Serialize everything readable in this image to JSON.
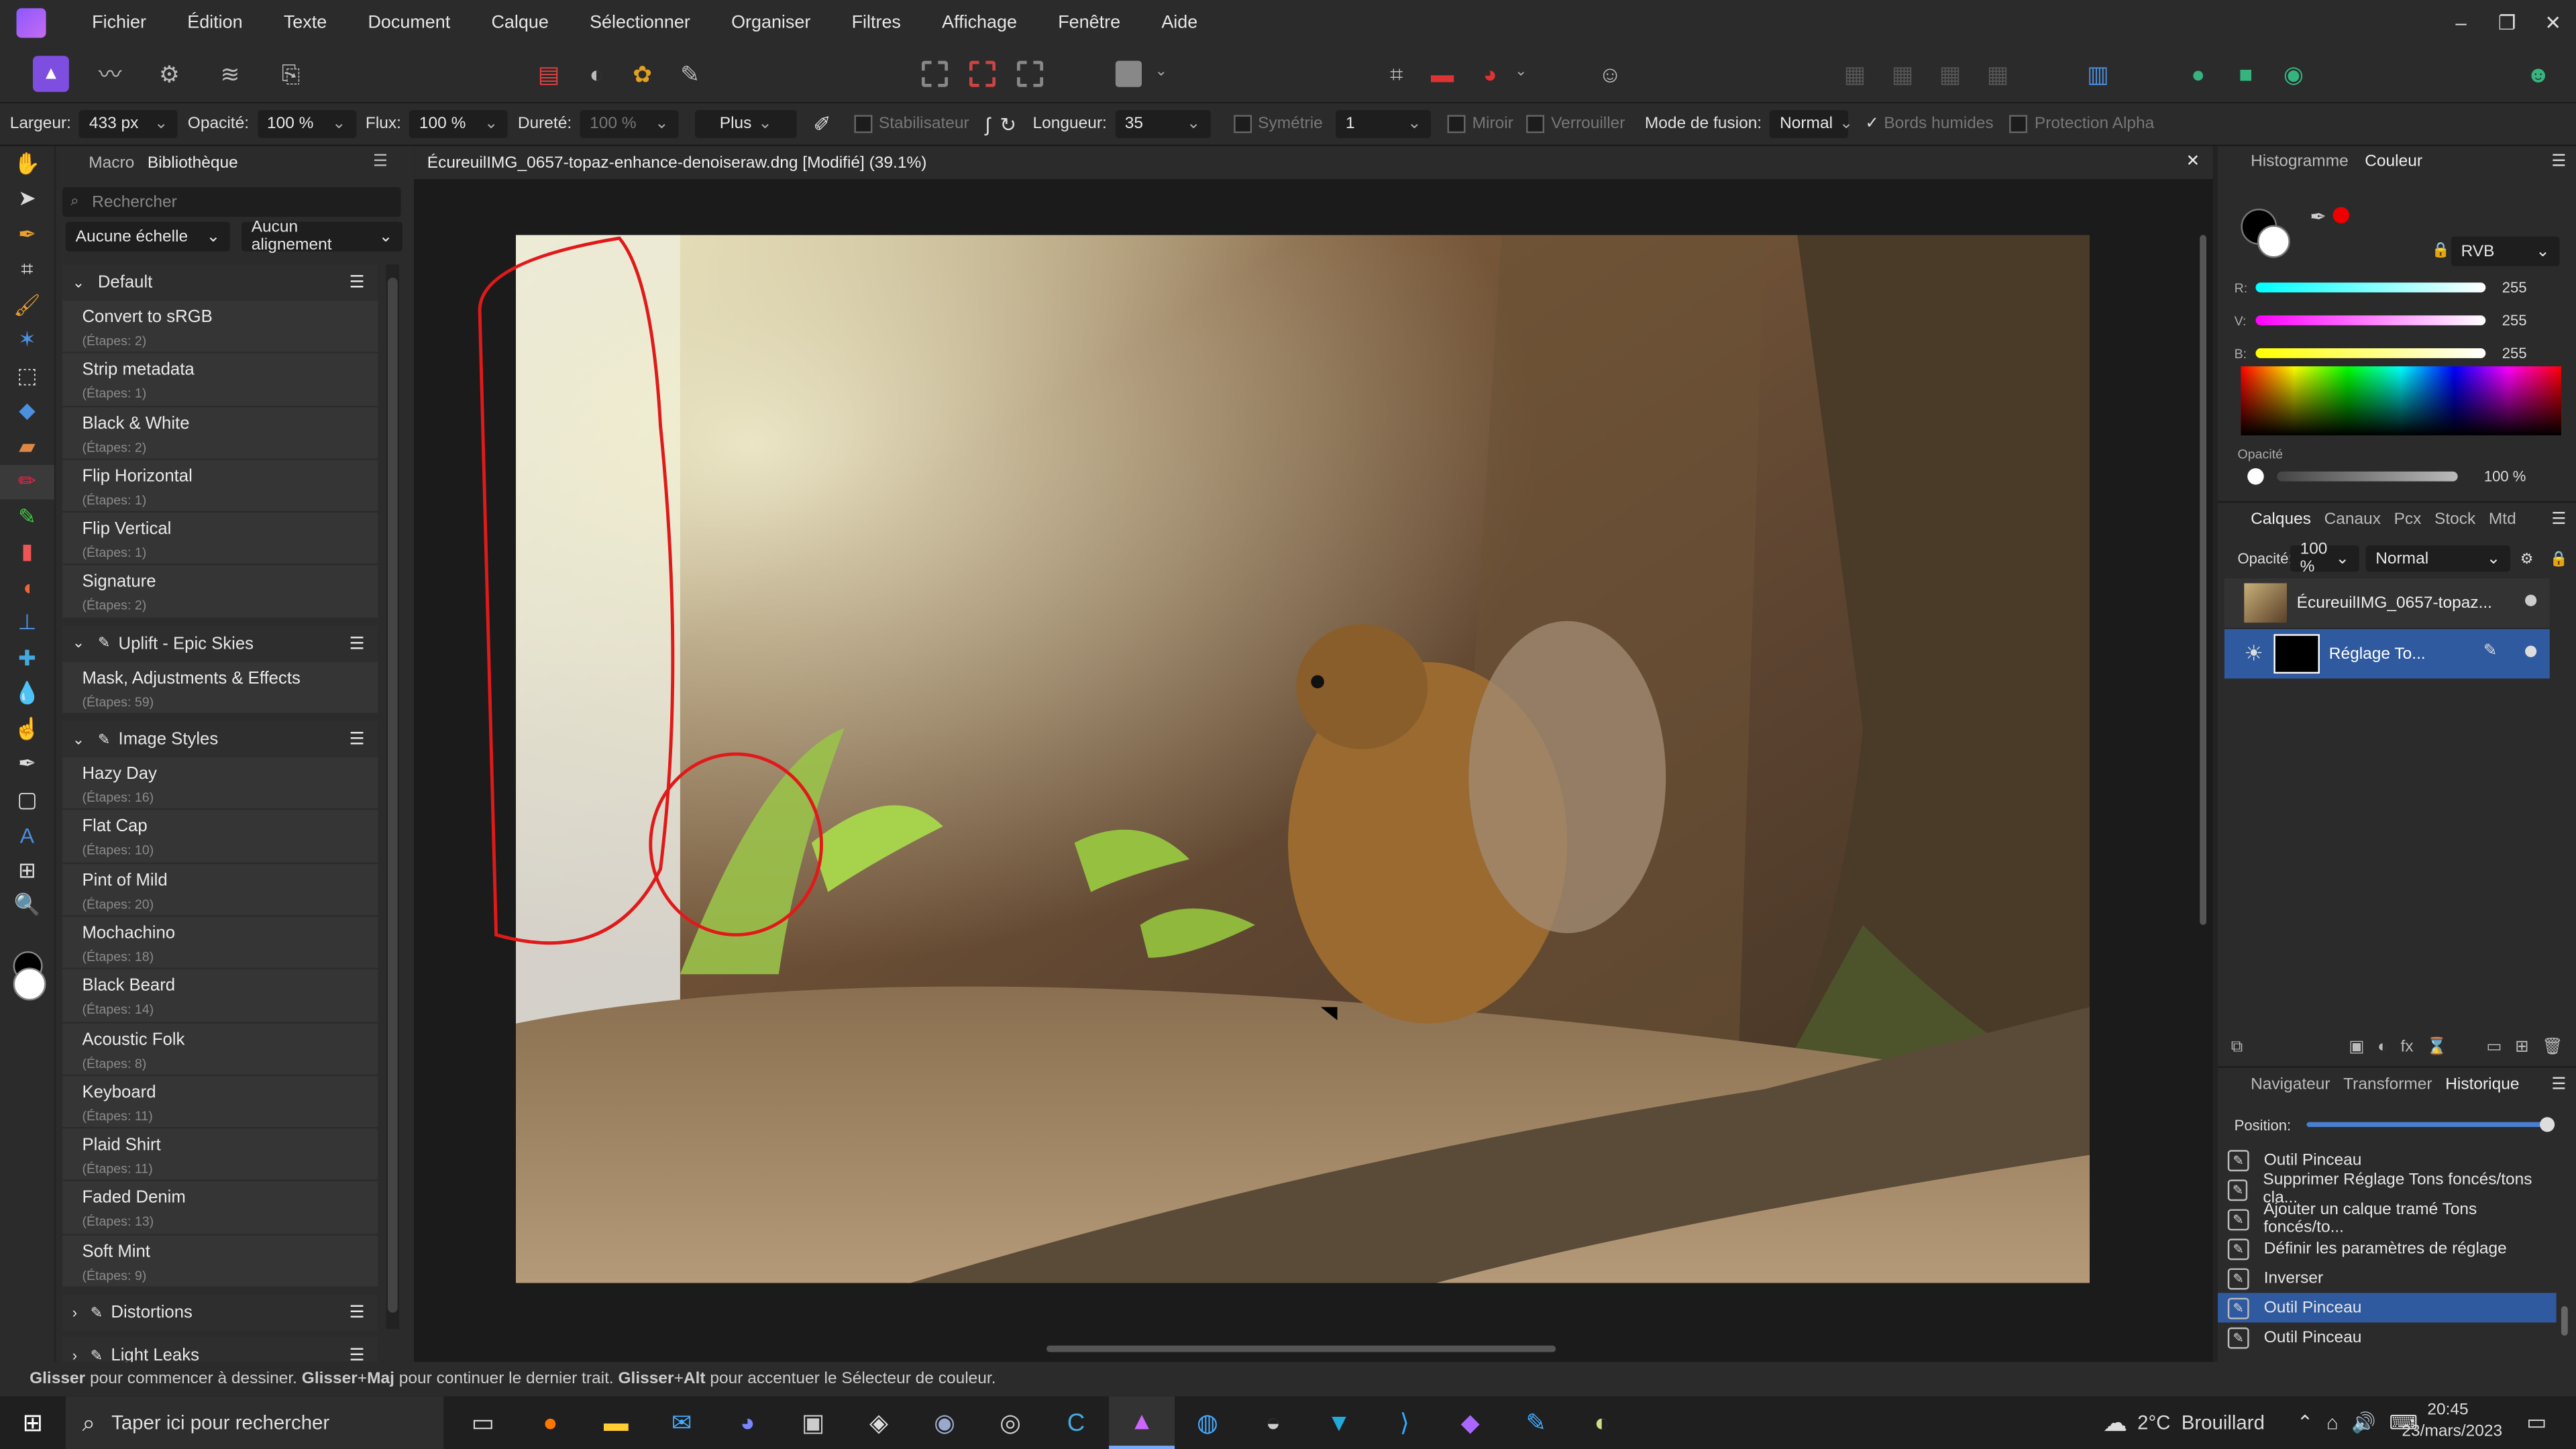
{
  "menu": {
    "items": [
      "Fichier",
      "Édition",
      "Texte",
      "Document",
      "Calque",
      "Sélectionner",
      "Organiser",
      "Filtres",
      "Affichage",
      "Fenêtre",
      "Aide"
    ]
  },
  "context_toolbar": {
    "largeur_label": "Largeur:",
    "largeur_value": "433 px",
    "opacite_label": "Opacité:",
    "opacite_value": "100 %",
    "flux_label": "Flux:",
    "flux_value": "100 %",
    "durete_label": "Dureté:",
    "durete_value": "100 %",
    "plus_label": "Plus",
    "stabilisateur_label": "Stabilisateur",
    "longueur_label": "Longueur:",
    "longueur_value": "35",
    "symetrie_label": "Symétrie",
    "symetrie_value": "1",
    "miroir_label": "Miroir",
    "verrouiller_label": "Verrouiller",
    "mode_label": "Mode de fusion:",
    "mode_value": "Normal",
    "bords_label": "Bords humides",
    "protection_label": "Protection Alpha"
  },
  "library": {
    "tabs": [
      "Macro",
      "Bibliothèque"
    ],
    "search_placeholder": "Rechercher",
    "scale_value": "Aucune échelle",
    "align_value": "Aucun alignement",
    "groups": [
      {
        "name": "Default",
        "items": [
          {
            "name": "Convert to sRGB",
            "steps": "(Étapes: 2)"
          },
          {
            "name": "Strip metadata",
            "steps": "(Étapes: 1)"
          },
          {
            "name": "Black & White",
            "steps": "(Étapes: 2)"
          },
          {
            "name": "Flip Horizontal",
            "steps": "(Étapes: 1)"
          },
          {
            "name": "Flip Vertical",
            "steps": "(Étapes: 1)"
          },
          {
            "name": "Signature",
            "steps": "(Étapes: 2)"
          }
        ]
      },
      {
        "name": "Uplift - Epic Skies",
        "items": [
          {
            "name": "Mask, Adjustments & Effects",
            "steps": "(Étapes: 59)"
          }
        ]
      },
      {
        "name": "Image Styles",
        "items": [
          {
            "name": "Hazy Day",
            "steps": "(Étapes: 16)"
          },
          {
            "name": "Flat Cap",
            "steps": "(Étapes: 10)"
          },
          {
            "name": "Pint of Mild",
            "steps": "(Étapes: 20)"
          },
          {
            "name": "Mochachino",
            "steps": "(Étapes: 18)"
          },
          {
            "name": "Black Beard",
            "steps": "(Étapes: 14)"
          },
          {
            "name": "Acoustic Folk",
            "steps": "(Étapes: 8)"
          },
          {
            "name": "Keyboard",
            "steps": "(Étapes: 11)"
          },
          {
            "name": "Plaid Shirt",
            "steps": "(Étapes: 11)"
          },
          {
            "name": "Faded Denim",
            "steps": "(Étapes: 13)"
          },
          {
            "name": "Soft Mint",
            "steps": "(Étapes: 9)"
          }
        ]
      },
      {
        "name": "Distortions",
        "items": []
      },
      {
        "name": "Light Leaks",
        "items": []
      }
    ]
  },
  "document": {
    "title": "ÉcureuilIMG_0657-topaz-enhance-denoiseraw.dng [Modifié] (39.1%)"
  },
  "color_panel": {
    "tabs": [
      "Histogramme",
      "Couleur"
    ],
    "model": "RVB",
    "channels": [
      {
        "label": "R:",
        "value": "255"
      },
      {
        "label": "V:",
        "value": "255"
      },
      {
        "label": "B:",
        "value": "255"
      }
    ],
    "opacity_label": "Opacité",
    "opacity_value": "100 %"
  },
  "layers_panel": {
    "tabs": [
      "Calques",
      "Canaux",
      "Pcx",
      "Stock",
      "Mtd"
    ],
    "opacity_label": "Opacité:",
    "opacity_value": "100 %",
    "blend_value": "Normal",
    "layers": [
      {
        "name": "ÉcureuilIMG_0657-topaz..."
      },
      {
        "name": "Réglage To..."
      }
    ]
  },
  "history_panel": {
    "tabs": [
      "Navigateur",
      "Transformer",
      "Historique"
    ],
    "position_label": "Position:",
    "items": [
      "Outil Pinceau",
      "Supprimer Réglage Tons foncés/tons cla...",
      "Ajouter un calque tramé Tons foncés/to...",
      "Définir les paramètres de réglage",
      "Inverser",
      "Outil Pinceau",
      "Outil Pinceau"
    ],
    "selected_index": 5
  },
  "status": {
    "part1": "Glisser",
    "part2": " pour commencer à dessiner. ",
    "part3": "Glisser",
    "part4": "+",
    "part5": "Maj",
    "part6": " pour continuer le dernier trait. ",
    "part7": "Glisser",
    "part8": "+",
    "part9": "Alt",
    "part10": " pour accentuer le Sélecteur de couleur."
  },
  "taskbar": {
    "search_placeholder": "Taper ici pour rechercher",
    "weather": "2°C  Brouillard",
    "time": "20:45",
    "date": "23/mars/2023"
  },
  "colors": {
    "accent": "#4a7fd0",
    "selection": "#2f5aa0",
    "annotation": "#e01a1a"
  }
}
